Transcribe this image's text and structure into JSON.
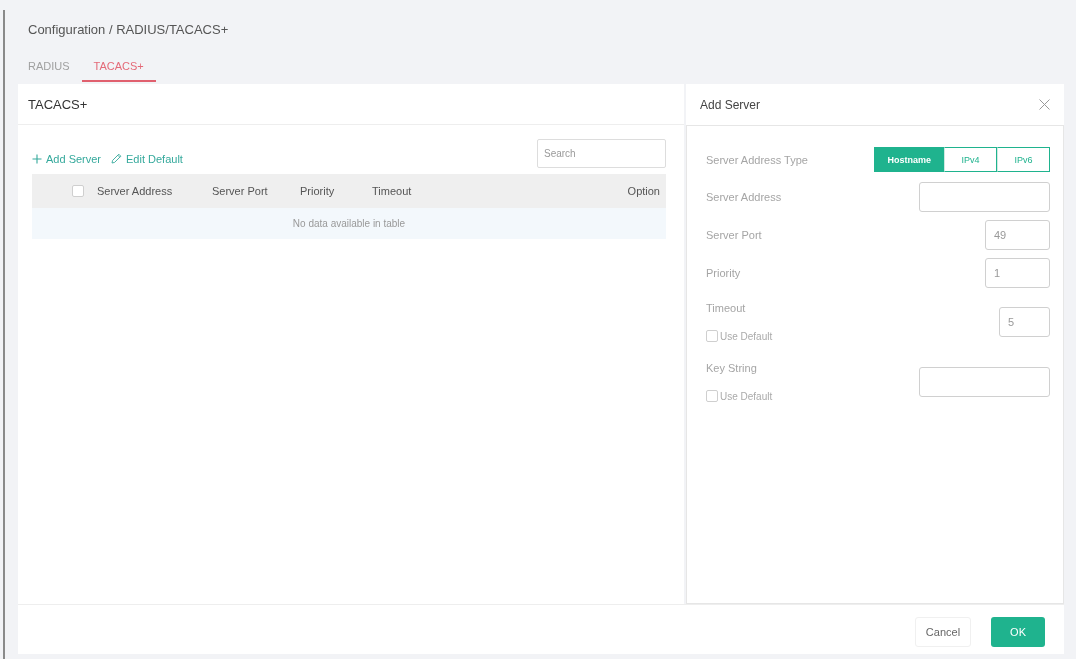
{
  "breadcrumb": "Configuration / RADIUS/TACACS+",
  "tabs": [
    {
      "label": "RADIUS",
      "selected": false
    },
    {
      "label": "TACACS+",
      "selected": true
    }
  ],
  "list_panel": {
    "title": "TACACS+",
    "toolbar": [
      {
        "kind": "add",
        "label": "Add Server"
      },
      {
        "kind": "edit",
        "label": "Edit Default"
      }
    ],
    "search": {
      "placeholder": "Search"
    },
    "table": {
      "select_all": {
        "checked": false
      },
      "columns": [
        "Server Address",
        "Server Port",
        "Priority",
        "Timeout",
        "Option"
      ],
      "empty_message": "No data available in table"
    }
  },
  "dialog": {
    "title": "Add Server",
    "fields": [
      {
        "kind": "segmented",
        "label": "Server Address Type",
        "options": [
          {
            "label": "Hostname",
            "selected": true
          },
          {
            "label": "IPv4",
            "selected": false
          },
          {
            "label": "IPv6",
            "selected": false
          }
        ]
      },
      {
        "kind": "text",
        "label": "Server Address"
      },
      {
        "kind": "number",
        "label": "Server Port",
        "value": "49"
      },
      {
        "kind": "number",
        "label": "Priority",
        "value": "1"
      },
      {
        "kind": "number",
        "label": "Timeout",
        "value": "5",
        "use_default": {
          "label": "Use Default",
          "checked": false
        }
      },
      {
        "kind": "text",
        "label": "Key String",
        "use_default": {
          "label": "Use Default",
          "checked": false
        }
      }
    ],
    "buttons": [
      {
        "kind": "cancel",
        "label": "Cancel"
      },
      {
        "kind": "submit",
        "label": "OK"
      }
    ]
  }
}
